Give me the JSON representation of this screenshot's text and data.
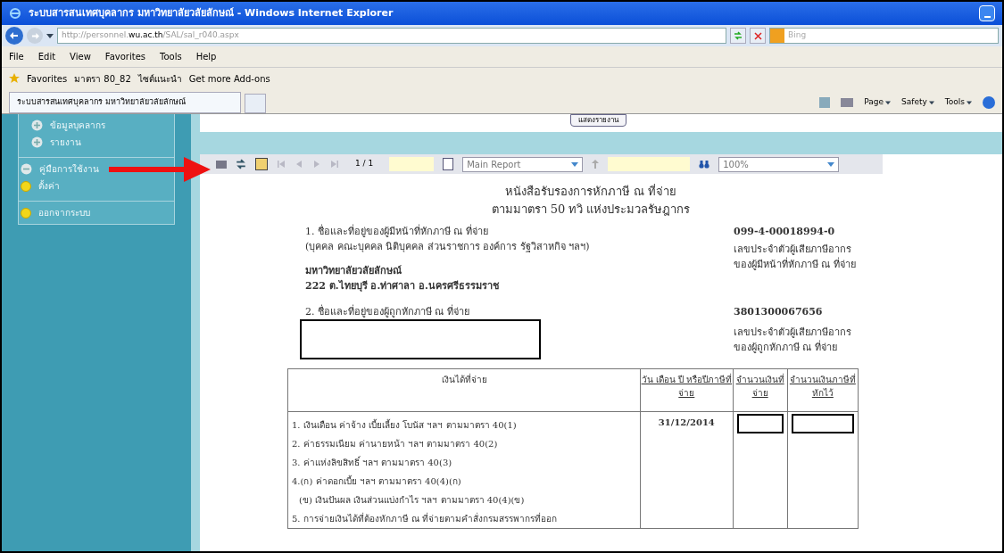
{
  "window": {
    "title": "ระบบสารสนเทศบุคลากร มหาวิทยาลัยวลัยลักษณ์ - Windows Internet Explorer"
  },
  "address_bar": {
    "url_prefix": "http://personnel.",
    "url_host": "wu.ac.th",
    "url_path": "/SAL/sal_r040.aspx",
    "search_placeholder": "Bing"
  },
  "menu_bar": [
    "File",
    "Edit",
    "View",
    "Favorites",
    "Tools",
    "Help"
  ],
  "favorites_bar": {
    "label": "Favorites",
    "links": [
      "มาตรา 80_82",
      "ไซต์แนะนำ",
      "Get more Add-ons"
    ]
  },
  "tabs": [
    {
      "label": "ระบบสารสนเทศบุคลากร มหาวิทยาลัยวลัยลักษณ์",
      "selected": true
    }
  ],
  "command_bar": [
    "Page",
    "Safety",
    "Tools"
  ],
  "sidebar": {
    "groups": [
      [
        {
          "label": "ข้อมูลบุคลากร",
          "kind": "plus",
          "nested": true
        },
        {
          "label": "รายงาน",
          "kind": "plus",
          "nested": true
        }
      ],
      [
        {
          "label": "คู่มือการใช้งาน",
          "kind": "minus",
          "nested": false
        },
        {
          "label": "ตั้งค่า",
          "kind": "bullet",
          "nested": false
        }
      ],
      [
        {
          "label": "ออกจากระบบ",
          "kind": "bullet",
          "nested": false
        }
      ]
    ]
  },
  "show_report_button": "แสดงรายงาน",
  "report_toolbar": {
    "group_tree_on": true,
    "page": "1 / 1",
    "report_select": "Main Report",
    "zoom": "100%"
  },
  "document": {
    "title": "หนังสือรับรองการหักภาษี ณ ที่จ่าย",
    "subtitle": "ตามมาตรา 50 ทวิ แห่งประมวลรัษฎากร",
    "payer": {
      "heading": "1. ชื่อและที่อยู่ของผู้มีหน้าที่หักภาษี ณ ที่จ่าย",
      "note": "(บุคคล คณะบุคคล นิติบุคคล ส่วนราชการ องค์การ รัฐวิสาหกิจ ฯลฯ)",
      "name": "มหาวิทยาลัยวลัยลักษณ์",
      "address": "222 ต.ไทยบุรี อ.ท่าศาลา อ.นครศรีธรรมราช",
      "tax_id": "099-4-00018994-0",
      "tax_id_label": [
        "เลขประจำตัวผู้เสียภาษีอากร",
        "ของผู้มีหน้าที่หักภาษี ณ ที่จ่าย"
      ]
    },
    "payee": {
      "heading": "2. ชื่อและที่อยู่ของผู้ถูกหักภาษี ณ ที่จ่าย",
      "tax_id": "3801300067656",
      "tax_id_label": [
        "เลขประจำตัวผู้เสียภาษีอากร",
        "ของผู้ถูกหักภาษี ณ ที่จ่าย"
      ]
    },
    "table": {
      "columns": [
        "เงินได้ที่จ่าย",
        "วัน เดือน ปี หรือปีภาษีที่จ่าย",
        "จำนวนเงินที่จ่าย",
        "จำนวนเงินภาษีที่หักไว้"
      ],
      "income_items": [
        "1. เงินเดือน ค่าจ้าง เบี้ยเลี้ยง โบนัส ฯลฯ ตามมาตรา 40(1)",
        "2. ค่าธรรมเนียม ค่านายหน้า ฯลฯ ตามมาตรา 40(2)",
        "3. ค่าแห่งลิขสิทธิ์ ฯลฯ ตามมาตรา 40(3)",
        "4.(ก) ค่าดอกเบี้ย ฯลฯ ตามมาตรา 40(4)(ก)",
        "(ข) เงินปันผล เงินส่วนแบ่งกำไร ฯลฯ ตามมาตรา 40(4)(ข)",
        "5. การจ่ายเงินได้ที่ต้องหักภาษี ณ ที่จ่ายตามคำสั่งกรมสรรพากรที่ออก"
      ],
      "date": "31/12/2014"
    }
  }
}
